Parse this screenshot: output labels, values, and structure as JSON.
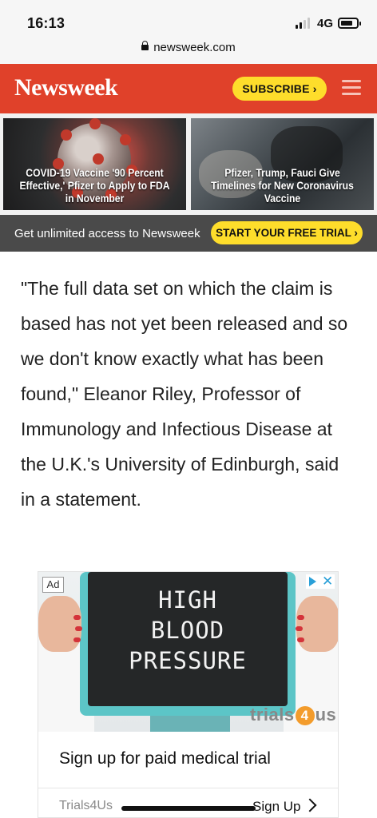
{
  "status": {
    "time": "16:13",
    "network": "4G"
  },
  "browser": {
    "url": "newsweek.com"
  },
  "header": {
    "logo": "Newsweek",
    "subscribe_label": "SUBSCRIBE ›"
  },
  "stories": [
    {
      "title": "COVID-19 Vaccine '90 Percent Effective,' Pfizer to Apply to FDA in November"
    },
    {
      "title": "Pfizer, Trump, Fauci Give Timelines for New Coronavirus Vaccine"
    }
  ],
  "promo": {
    "text": "Get unlimited access to Newsweek",
    "cta_label": "START YOUR FREE TRIAL ›"
  },
  "article": {
    "paragraph": "\"The full data set on which the claim is based has not yet been released and so we don't know exactly what has been found,\" Eleanor Riley, Professor of Immunology and Infectious Disease at the U.K.'s University of Edinburgh, said in a statement."
  },
  "ad": {
    "badge": "Ad",
    "board_lines": [
      "HIGH",
      "BLOOD",
      "PRESSURE"
    ],
    "brand_prefix": "trials",
    "brand_number": "4",
    "brand_suffix": "us",
    "headline": "Sign up for paid medical trial",
    "source": "Trials4Us",
    "cta": "Sign Up",
    "accent_color": "#2aa0d8"
  },
  "colors": {
    "header": "#e0412a",
    "cta_yellow": "#fedd2b",
    "promo_bar": "#4a4a4a"
  }
}
